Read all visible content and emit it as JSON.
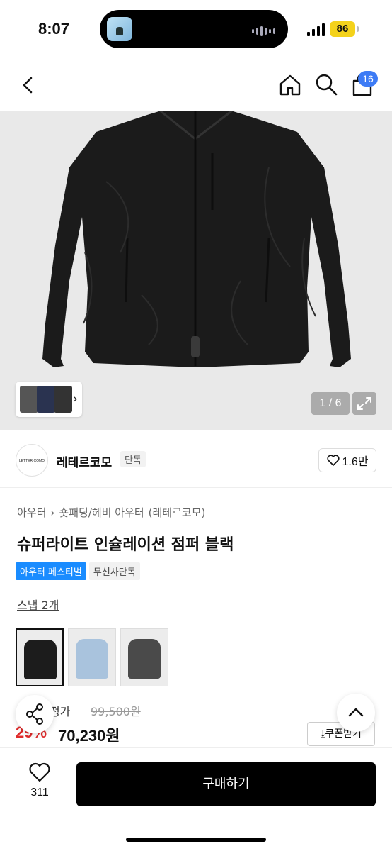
{
  "status": {
    "time": "8:07",
    "battery": "86"
  },
  "nav": {
    "cart_count": "16"
  },
  "gallery": {
    "counter": "1 / 6"
  },
  "brand": {
    "logo_text": "LETTER COMO",
    "name": "레테르코모",
    "tag": "단독",
    "likes": "1.6만"
  },
  "breadcrumb": {
    "items": [
      "아우터",
      "숏패딩/헤비 아우터",
      "(레테르코모)"
    ]
  },
  "product": {
    "title": "슈퍼라이트 인슐레이션 점퍼 블랙",
    "tags": [
      "아우터 페스티벌",
      "무신사단독"
    ],
    "snap": "스냅 2개",
    "variants": [
      "black",
      "light-blue",
      "charcoal"
    ]
  },
  "price": {
    "label_fragment": "정가",
    "original": "99,500원",
    "discount": "29%",
    "final": "70,230원",
    "coupon_label": "쿠폰받기"
  },
  "bottom": {
    "like_count": "311",
    "buy_label": "구매하기"
  },
  "colors": {
    "accent": "#1a8cff",
    "discount": "#e02b2b",
    "cart_badge": "#3d7bf5",
    "battery": "#f4d21b"
  }
}
